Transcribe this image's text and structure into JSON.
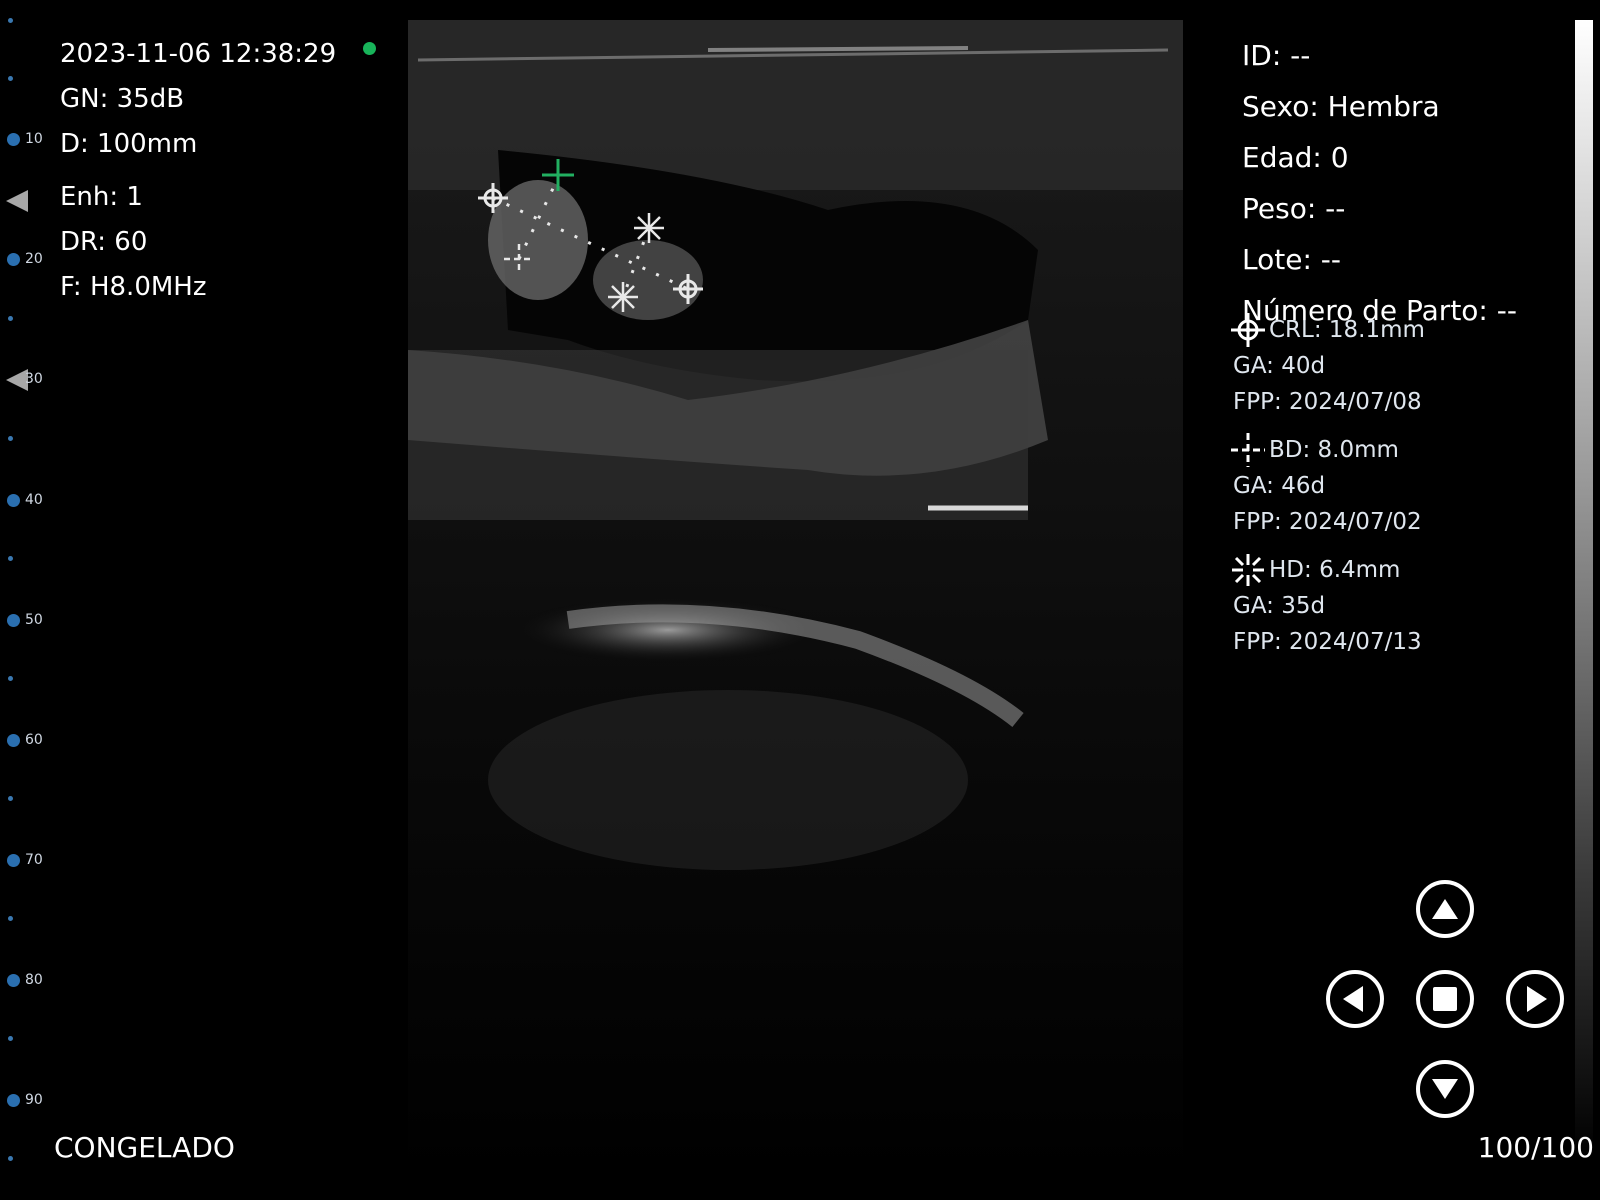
{
  "status": {
    "datetime": "2023-11-06 12:38:29",
    "gain": "GN: 35dB",
    "depth": "D: 100mm",
    "enhancement": "Enh: 1",
    "dynamic_range": "DR: 60",
    "frequency": "F: H8.0MHz",
    "indicator_color": "#18b45a"
  },
  "ruler": {
    "labels": [
      "10",
      "20",
      "30",
      "40",
      "50",
      "60",
      "70",
      "80",
      "90"
    ],
    "unit_color": "#2a6fb0"
  },
  "patient": {
    "id": "ID: --",
    "sex": "Sexo: Hembra",
    "age": "Edad: 0",
    "weight": "Peso: --",
    "batch": "Lote: --",
    "parity": "Número de Parto: --"
  },
  "measurements": [
    {
      "icon": "crosshair-circle-icon",
      "label": "CRL: 18.1mm",
      "ga": "GA: 40d",
      "due": "FPP: 2024/07/08"
    },
    {
      "icon": "dashed-cross-icon",
      "label": "BD: 8.0mm",
      "ga": "GA: 46d",
      "due": "FPP: 2024/07/02"
    },
    {
      "icon": "asterisk-icon",
      "label": "HD: 6.4mm",
      "ga": "GA: 35d",
      "due": "FPP: 2024/07/13"
    }
  ],
  "footer": {
    "state": "CONGELADO",
    "frames": "100/100"
  },
  "controls": {
    "up": "chevron-up-icon",
    "down": "chevron-down-icon",
    "left": "chevron-left-icon",
    "right": "chevron-right-icon",
    "stop": "stop-icon"
  }
}
